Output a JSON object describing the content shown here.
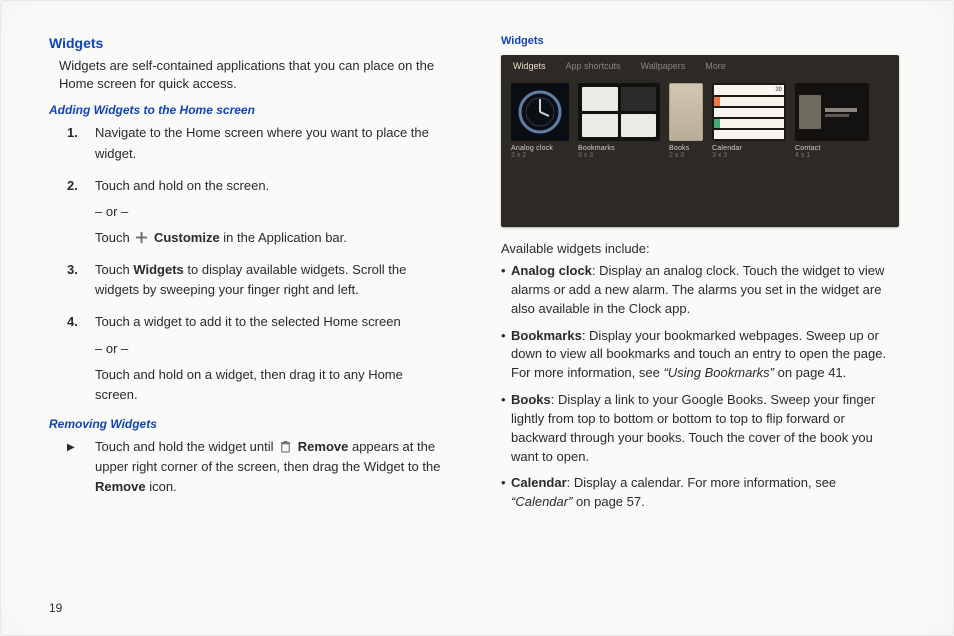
{
  "pageNumber": "19",
  "left": {
    "heading": "Widgets",
    "intro": "Widgets are self-contained applications that you can place on the Home screen for quick access.",
    "addingHeading": "Adding Widgets to the Home screen",
    "steps": {
      "s1": "Navigate to the Home screen where you want to place the widget.",
      "s2a": "Touch and hold on the screen.",
      "or": "– or –",
      "s2b_pre": "Touch ",
      "s2b_bold": "Customize",
      "s2b_post": " in the Application bar.",
      "s3_pre": "Touch ",
      "s3_bold": "Widgets",
      "s3_post": " to display available widgets. Scroll the widgets by sweeping your finger right and left.",
      "s4a": "Touch a widget to add it to the selected Home screen",
      "s4b": "Touch and hold on a widget, then drag it to any Home screen."
    },
    "removingHeading": "Removing Widgets",
    "remove_pre": "Touch and hold the widget until ",
    "remove_bold1": "Remove",
    "remove_mid": " appears at the upper right corner of the screen, then drag the Widget to the ",
    "remove_bold2": "Remove",
    "remove_post": " icon."
  },
  "right": {
    "heading": "Widgets",
    "screenshot": {
      "tabs": {
        "t1": "Widgets",
        "t2": "App shortcuts",
        "t3": "Wallpapers",
        "t4": "More"
      },
      "items": [
        {
          "label": "Analog clock",
          "dim": "2 x 2"
        },
        {
          "label": "Bookmarks",
          "dim": "3 x 3"
        },
        {
          "label": "Books",
          "dim": "2 x 3"
        },
        {
          "label": "Calendar",
          "dim": "3 x 3"
        },
        {
          "label": "Contact",
          "dim": "4 x 1"
        }
      ],
      "calHeader": "30"
    },
    "available": "Available widgets include:",
    "items": {
      "clock": {
        "name": "Analog clock",
        "text": ": Display an analog clock. Touch the widget to view alarms or add a new alarm. The alarms you set in the widget are also available in the Clock app."
      },
      "bookmarks": {
        "name": "Bookmarks",
        "text": ": Display your bookmarked webpages. Sweep up or down to view all bookmarks and touch an entry to open the page. For more information, see ",
        "ref": "“Using Bookmarks”",
        "post": " on page 41."
      },
      "books": {
        "name": "Books",
        "text": ": Display a link to your Google Books. Sweep your finger lightly from top to bottom or bottom to top to flip forward or backward through your books. Touch the cover of the book you want to open."
      },
      "calendar": {
        "name": "Calendar",
        "text": ": Display a calendar. For more information, see ",
        "ref": "“Calendar”",
        "post": " on page 57."
      }
    }
  }
}
